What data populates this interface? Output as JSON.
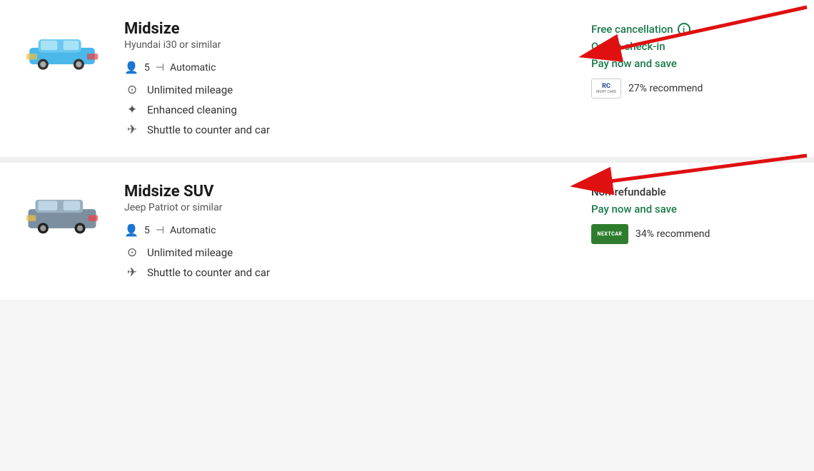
{
  "cards": [
    {
      "id": "card-midsize",
      "title": "Midsize",
      "subtitle": "Hyundai i30 or similar",
      "specs": {
        "passengers": "5",
        "transmission": "Automatic"
      },
      "features": [
        {
          "id": "unlimited-mileage",
          "icon": "speedometer",
          "label": "Unlimited mileage"
        },
        {
          "id": "enhanced-cleaning",
          "icon": "sparkle",
          "label": "Enhanced cleaning"
        },
        {
          "id": "shuttle",
          "icon": "plane",
          "label": "Shuttle to counter and car"
        }
      ],
      "right": {
        "cancellation": "Free cancellation",
        "cancellation_type": "green",
        "has_info": true,
        "online_checkin": "Online check-in",
        "pay_save": "Pay now and save",
        "recommend_pct": "27% recommend",
        "brand": "RC"
      }
    },
    {
      "id": "card-midsize-suv",
      "title": "Midsize SUV",
      "subtitle": "Jeep Patriot or similar",
      "specs": {
        "passengers": "5",
        "transmission": "Automatic"
      },
      "features": [
        {
          "id": "unlimited-mileage",
          "icon": "speedometer",
          "label": "Unlimited mileage"
        },
        {
          "id": "shuttle",
          "icon": "plane",
          "label": "Shuttle to counter and car"
        }
      ],
      "right": {
        "cancellation": "Non-refundable",
        "cancellation_type": "dark",
        "has_info": false,
        "online_checkin": null,
        "pay_save": "Pay now and save",
        "recommend_pct": "34% recommend",
        "brand": "NEXTCAR"
      }
    }
  ],
  "arrows": [
    {
      "id": "arrow1",
      "target": "free-cancellation"
    },
    {
      "id": "arrow2",
      "target": "non-refundable"
    }
  ]
}
